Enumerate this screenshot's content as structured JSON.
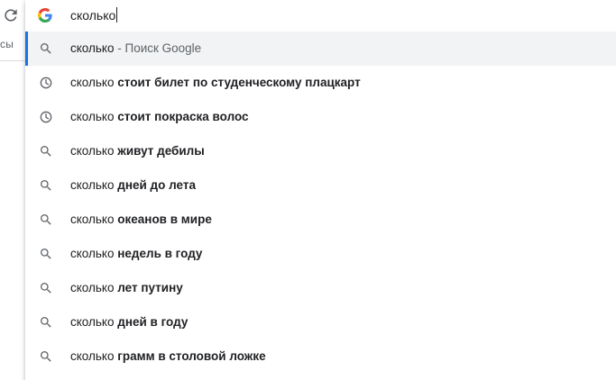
{
  "left_panel": {
    "partial_text": "сы"
  },
  "omnibox": {
    "input_value": "сколько",
    "engine_icon": "google-g-icon"
  },
  "suggestions": [
    {
      "icon": "search-icon",
      "query": "сколько",
      "rest": "",
      "desc": " - Поиск Google",
      "selected": true
    },
    {
      "icon": "history-icon",
      "query": "сколько",
      "rest": "стоит билет по студенческому плацкарт",
      "desc": ""
    },
    {
      "icon": "history-icon",
      "query": "сколько",
      "rest": "стоит покраска волос",
      "desc": ""
    },
    {
      "icon": "search-icon",
      "query": "сколько",
      "rest": "живут дебилы",
      "desc": ""
    },
    {
      "icon": "search-icon",
      "query": "сколько",
      "rest": "дней до лета",
      "desc": ""
    },
    {
      "icon": "search-icon",
      "query": "сколько",
      "rest": "океанов в мире",
      "desc": ""
    },
    {
      "icon": "search-icon",
      "query": "сколько",
      "rest": "недель в году",
      "desc": ""
    },
    {
      "icon": "search-icon",
      "query": "сколько",
      "rest": "лет путину",
      "desc": ""
    },
    {
      "icon": "search-icon",
      "query": "сколько",
      "rest": "дней в году",
      "desc": ""
    },
    {
      "icon": "search-icon",
      "query": "сколько",
      "rest": "грамм в столовой ложке",
      "desc": ""
    }
  ],
  "colors": {
    "selected_bg": "#f1f3f4",
    "accent": "#1a73e8",
    "text": "#202124",
    "muted": "#5f6368",
    "icon": "#5f6368"
  }
}
